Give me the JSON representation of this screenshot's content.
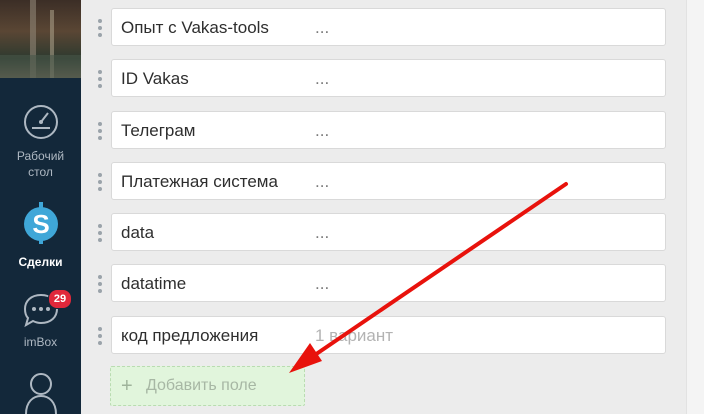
{
  "sidebar": {
    "items": [
      {
        "label": "Рабочий стол",
        "icon": "dashboard-gauge-icon"
      },
      {
        "label": "Сделки",
        "icon": "dollar-icon"
      },
      {
        "label": "imBox",
        "icon": "chat-bubble-icon",
        "badge": "29"
      },
      {
        "label": "",
        "icon": "contacts-icon"
      }
    ]
  },
  "fields": [
    {
      "name": "Опыт с Vakas-tools",
      "value": "..."
    },
    {
      "name": "ID Vakas",
      "value": "..."
    },
    {
      "name": "Телеграм",
      "value": "..."
    },
    {
      "name": "Платежная система",
      "value": "..."
    },
    {
      "name": "data",
      "value": "..."
    },
    {
      "name": "datatime",
      "value": "..."
    },
    {
      "name": "код предложения",
      "value": "1 вариант"
    }
  ],
  "add_field": {
    "label": "Добавить поле",
    "icon": "plus-icon"
  },
  "colors": {
    "sidebar_bg": "#13283a",
    "badge": "#e0283b",
    "arrow": "#e8120c",
    "add_bg": "#e1f5dc"
  }
}
